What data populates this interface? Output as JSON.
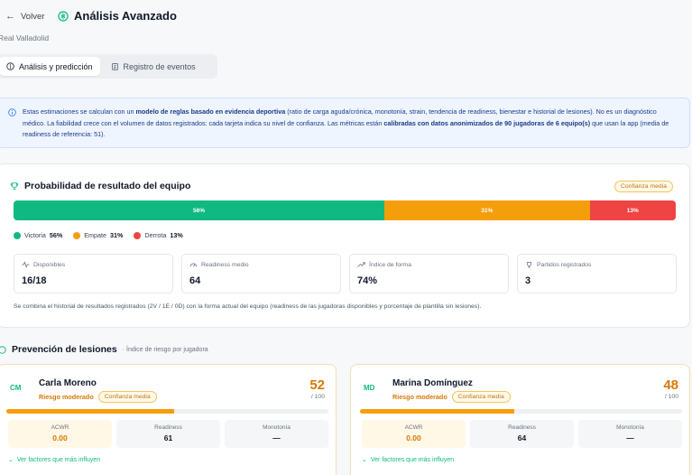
{
  "header": {
    "back_label": "Volver",
    "title": "Análisis Avanzado",
    "subtitle": "Real Valladolid"
  },
  "tabs": [
    {
      "label": "Análisis y predicción",
      "active": true
    },
    {
      "label": "Registro de eventos",
      "active": false
    }
  ],
  "info": {
    "p1": "Estas estimaciones se calculan con un ",
    "b1": "modelo de reglas basado en evidencia deportiva",
    "p2": " (ratio de carga aguda/crónica, monotonía, strain, tendencia de readiness, bienestar e historial de lesiones). No es un diagnóstico médico. La fiabilidad crece con el volumen de datos registrados: cada tarjeta indica su nivel de confianza. Las métricas están ",
    "b2": "calibradas con datos anonimizados de 90 jugadoras de 6 equipo(s)",
    "p3": " que usan la app (media de readiness de referencia: 51)."
  },
  "outcome": {
    "title": "Probabilidad de resultado del equipo",
    "confidence": "Confianza media",
    "segments": [
      {
        "label": "56%",
        "value": 56,
        "color": "#10b981"
      },
      {
        "label": "31%",
        "value": 31,
        "color": "#f59e0b"
      },
      {
        "label": "13%",
        "value": 13,
        "color": "#ef4444"
      }
    ],
    "legend": [
      {
        "name": "Victoria",
        "value": "56%",
        "color": "#10b981"
      },
      {
        "name": "Empate",
        "value": "31%",
        "color": "#f59e0b"
      },
      {
        "name": "Derrota",
        "value": "13%",
        "color": "#ef4444"
      }
    ],
    "stats": [
      {
        "label": "Disponibles",
        "value": "16/18",
        "icon": "pulse-icon"
      },
      {
        "label": "Readiness medio",
        "value": "64",
        "icon": "gauge-icon"
      },
      {
        "label": "Índice de forma",
        "value": "74%",
        "icon": "trend-up-icon"
      },
      {
        "label": "Partidos registrados",
        "value": "3",
        "icon": "trophy-icon"
      }
    ],
    "note": "Se combina el historial de resultados registrados (2V / 1E / 0D) con la forma actual del equipo (readiness de las jugadoras disponibles y porcentaje de plantilla sin lesiones)."
  },
  "injury": {
    "title": "Prevención de lesiones",
    "subtitle": "· Índice de riesgo por jugadora",
    "players": [
      {
        "initials": "CM",
        "name": "Carla Moreno",
        "risk": "Riesgo moderado",
        "confidence": "Confianza media",
        "score": "52",
        "out_of": "/ 100",
        "level": 52,
        "acwr_label": "ACWR",
        "acwr": "0.00",
        "readiness_label": "Readiness",
        "readiness": "61",
        "monotony_label": "Monotonía",
        "monotony": "—",
        "more": "Ver factores que más influyen"
      },
      {
        "initials": "MD",
        "name": "Marina Domínguez",
        "risk": "Riesgo moderado",
        "confidence": "Confianza media",
        "score": "48",
        "out_of": "/ 100",
        "level": 48,
        "acwr_label": "ACWR",
        "acwr": "0.00",
        "readiness_label": "Readiness",
        "readiness": "64",
        "monotony_label": "Monotonía",
        "monotony": "—",
        "more": "Ver factores que más influyen"
      }
    ]
  }
}
